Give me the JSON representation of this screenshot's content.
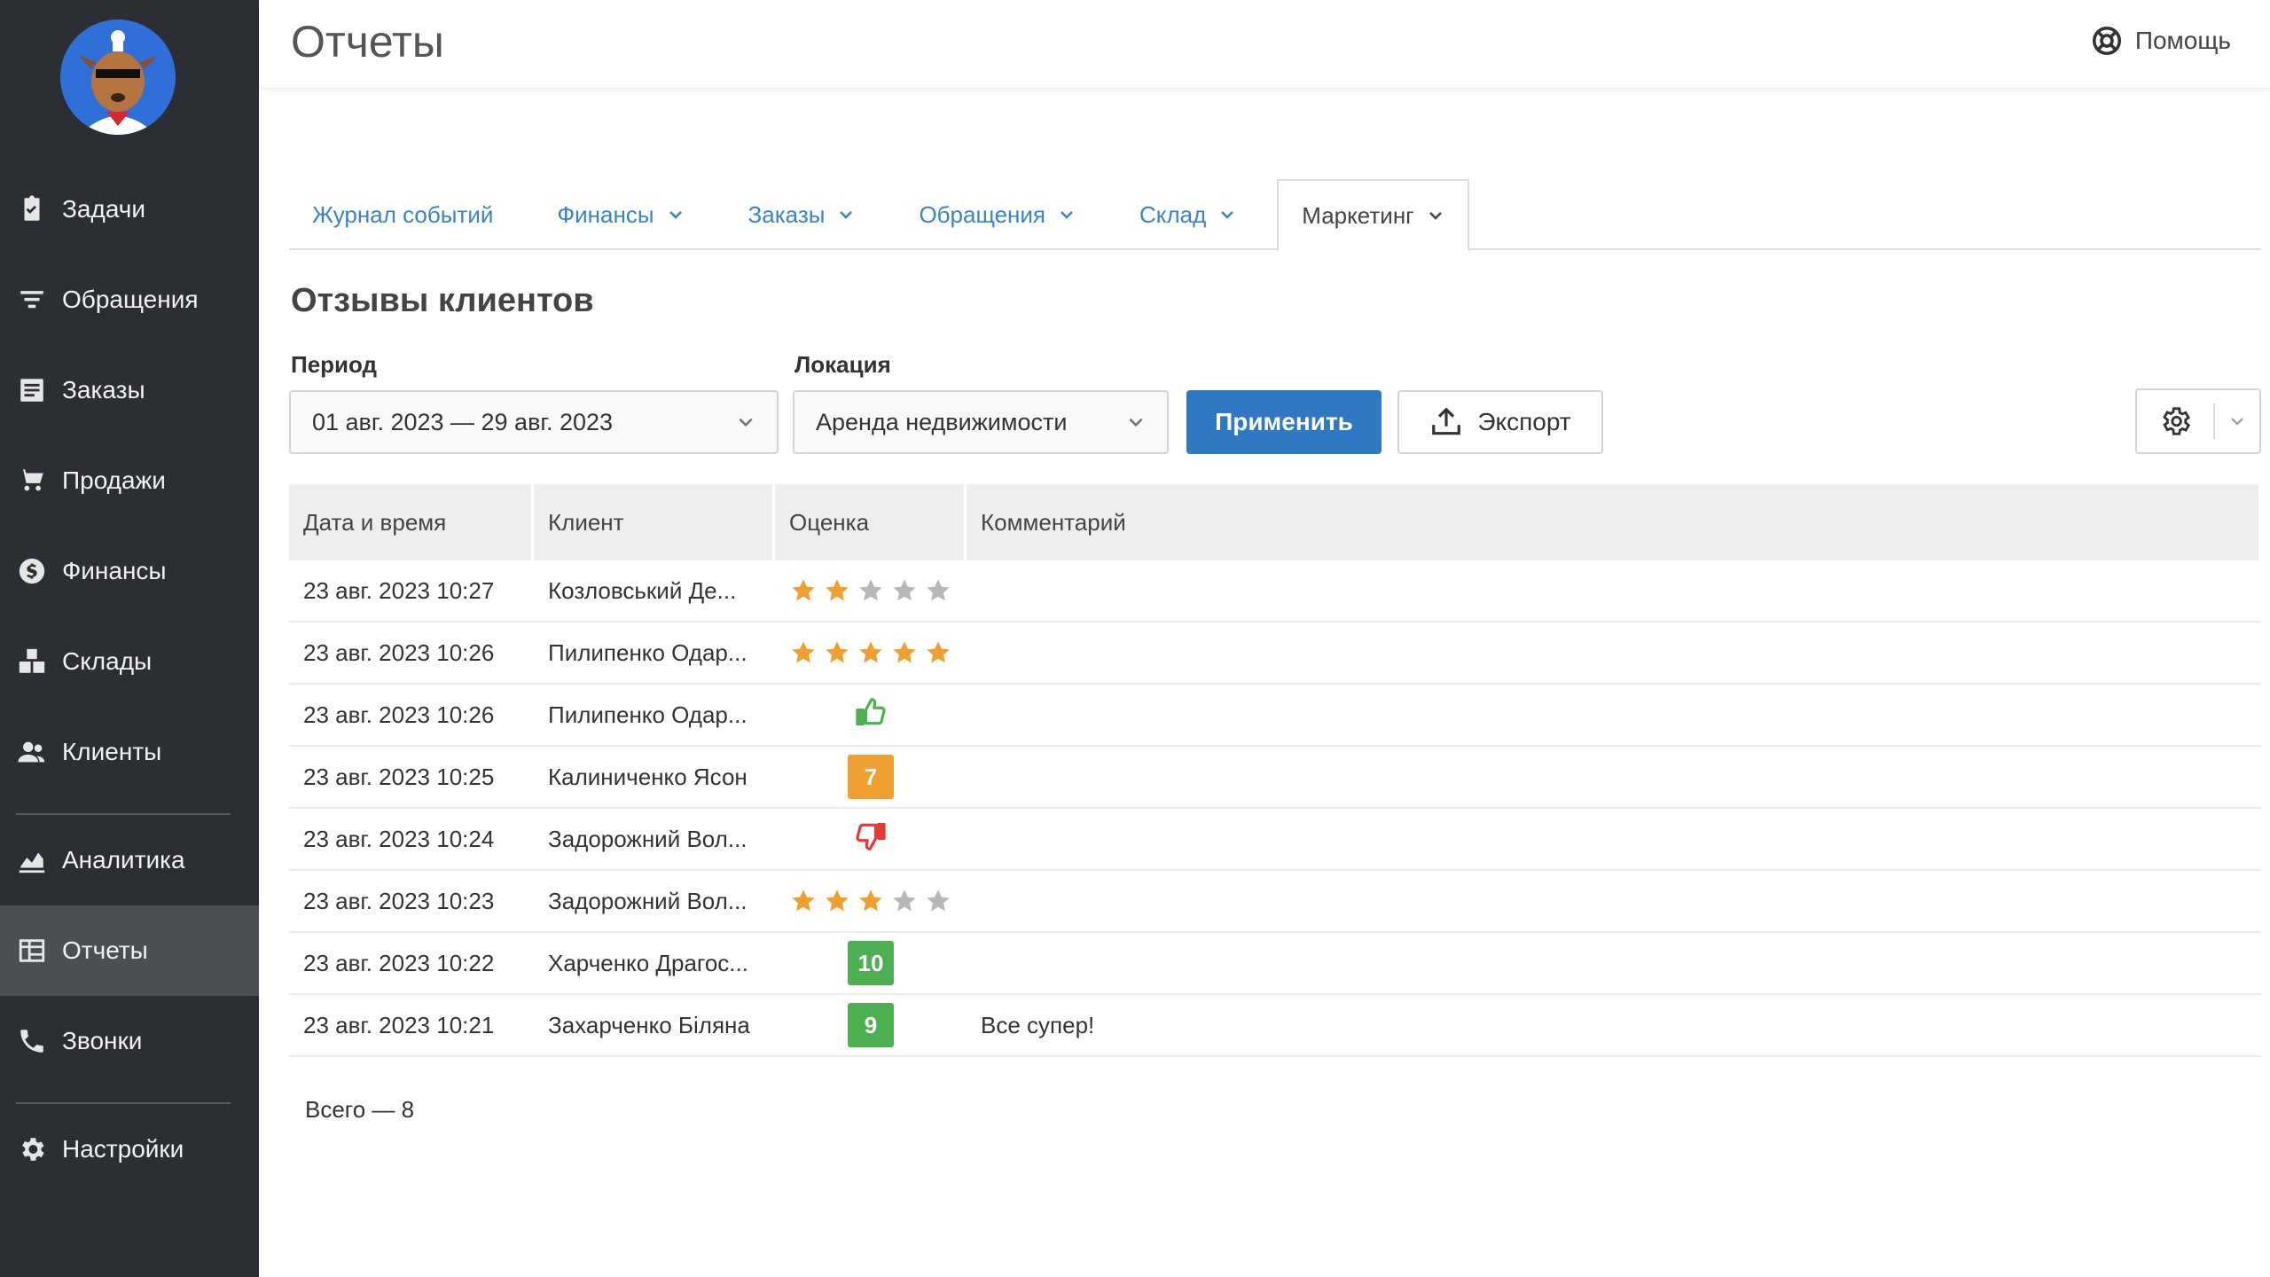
{
  "app": {
    "title": "Отчеты"
  },
  "header": {
    "help_label": "Помощь"
  },
  "sidebar": {
    "items": [
      {
        "label": "Задачи",
        "icon": "clipboard-icon"
      },
      {
        "label": "Обращения",
        "icon": "filter-icon"
      },
      {
        "label": "Заказы",
        "icon": "list-icon"
      },
      {
        "label": "Продажи",
        "icon": "cart-icon"
      },
      {
        "label": "Финансы",
        "icon": "dollar-icon"
      },
      {
        "label": "Склады",
        "icon": "boxes-icon"
      },
      {
        "label": "Клиенты",
        "icon": "users-icon"
      },
      {
        "label": "Аналитика",
        "icon": "chart-icon"
      },
      {
        "label": "Отчеты",
        "icon": "table-icon",
        "active": true
      },
      {
        "label": "Звонки",
        "icon": "phone-icon"
      },
      {
        "label": "Настройки",
        "icon": "gear-icon"
      }
    ]
  },
  "tabs": [
    {
      "label": "Журнал событий",
      "has_dropdown": false
    },
    {
      "label": "Финансы",
      "has_dropdown": true
    },
    {
      "label": "Заказы",
      "has_dropdown": true
    },
    {
      "label": "Обращения",
      "has_dropdown": true
    },
    {
      "label": "Склад",
      "has_dropdown": true
    },
    {
      "label": "Маркетинг",
      "has_dropdown": true,
      "active": true
    }
  ],
  "report": {
    "title": "Отзывы клиентов",
    "period_label": "Период",
    "period_value": "01 авг. 2023 — 29 авг. 2023",
    "location_label": "Локация",
    "location_value": "Аренда недвижимости",
    "apply_label": "Применить",
    "export_label": "Экспорт"
  },
  "table": {
    "columns": [
      "Дата и время",
      "Клиент",
      "Оценка",
      "Комментарий"
    ],
    "rows": [
      {
        "datetime": "23 авг. 2023 10:27",
        "client": "Козловський Де...",
        "rating": {
          "type": "stars",
          "value": 2,
          "max": 5
        },
        "comment": ""
      },
      {
        "datetime": "23 авг. 2023 10:26",
        "client": "Пилипенко Одар...",
        "rating": {
          "type": "stars",
          "value": 5,
          "max": 5
        },
        "comment": ""
      },
      {
        "datetime": "23 авг. 2023 10:26",
        "client": "Пилипенко Одар...",
        "rating": {
          "type": "thumb",
          "value": "up"
        },
        "comment": ""
      },
      {
        "datetime": "23 авг. 2023 10:25",
        "client": "Калиниченко Ясон",
        "rating": {
          "type": "score",
          "value": "7"
        },
        "comment": ""
      },
      {
        "datetime": "23 авг. 2023 10:24",
        "client": "Задорожний Вол...",
        "rating": {
          "type": "thumb",
          "value": "down"
        },
        "comment": ""
      },
      {
        "datetime": "23 авг. 2023 10:23",
        "client": "Задорожний Вол...",
        "rating": {
          "type": "stars",
          "value": 3,
          "max": 5
        },
        "comment": ""
      },
      {
        "datetime": "23 авг. 2023 10:22",
        "client": "Харченко Драгос...",
        "rating": {
          "type": "score",
          "value": "10"
        },
        "comment": ""
      },
      {
        "datetime": "23 авг. 2023 10:21",
        "client": "Захарченко Біляна",
        "rating": {
          "type": "score",
          "value": "9"
        },
        "comment": "Все супер!"
      }
    ]
  },
  "footer": {
    "total_label": "Всего — 8"
  },
  "colors": {
    "sidebar_bg": "#2b2f33",
    "accent": "#2f78c2",
    "star_on": "#f0a030",
    "star_off": "#b8b8b8",
    "score_mid": "#f0a030",
    "score_high": "#4caf50",
    "thumb_up": "#4caf50",
    "thumb_down": "#e53935"
  }
}
